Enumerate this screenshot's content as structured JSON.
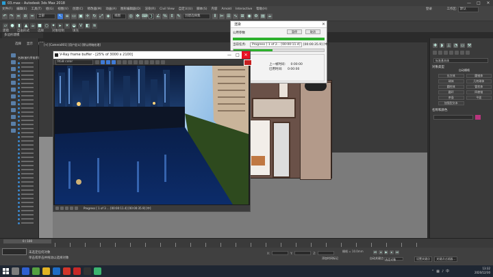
{
  "window": {
    "title": "03.max - Autodesk 3ds Max 2018",
    "controls": [
      "—",
      "□",
      "✕"
    ]
  },
  "menu": [
    "文件(F)",
    "编辑(E)",
    "工具(T)",
    "组(G)",
    "视图(V)",
    "创建(C)",
    "修改器(M)",
    "动画(A)",
    "图形编辑器(D)",
    "渲染(R)",
    "Civil View",
    "自定义(U)",
    "脚本(S)",
    "内容",
    "Arnold",
    "Interactive",
    "帮助(H)"
  ],
  "toolbar": {
    "selection_filter": "全部",
    "view_dropdown": "视图",
    "selection_set": "创建选择集"
  },
  "login": {
    "user": "登录",
    "workspace_label": "工作区:",
    "workspace": "默认"
  },
  "ribbon": {
    "tabs": [
      "建模",
      "自由形式",
      "选择",
      "对象绘制",
      "填充"
    ],
    "stage_label": "多边形建模"
  },
  "explorer": {
    "header": [
      "选择",
      "显示",
      "编辑"
    ],
    "root": "名称(按升序排序)",
    "rows": 40
  },
  "viewport": {
    "label": "[+] [Camera001] [用户定义] [默认明暗处理]"
  },
  "dialog": {
    "title": "渲染",
    "row1_label": "公用参数",
    "pause_label": "暂停",
    "cancel_label": "取消",
    "task_label": "当前任务:",
    "task_value": "Progress [ 1 of 2... [00:00:11.4]",
    "task_value2": "[00:00:35.9] [中]",
    "elapsed_label": "上一帧时间:",
    "elapsed_value": "0:00:00",
    "total_label": "已用时间:",
    "total_value": "0:00:00",
    "frame_label": "帧数:",
    "progress_task": 1.0,
    "progress_overall": 0.43
  },
  "vfb": {
    "title": "V-Ray frame buffer - [25% of 3000 x 2100]",
    "channel": "RGB color",
    "status": "Progress [ 1 of 3 ... [00:00:11.4] [00:00:35.9] [中]",
    "controls": [
      "—",
      "□",
      "✕"
    ]
  },
  "command_panel": {
    "dropdown": "标准基本体",
    "rollout1": "对象类型",
    "autogrid": "自动栅格",
    "objects": [
      "长方体",
      "圆锥体",
      "球体",
      "几何球体",
      "圆柱体",
      "管状体",
      "圆环",
      "四棱锥",
      "茶壶",
      "平面",
      "加强型文本"
    ],
    "rollout2": "名称和颜色",
    "color": "#b9357d"
  },
  "timeline": {
    "slider": "0 / 100"
  },
  "status": {
    "line1": "未选定任何对象",
    "line2": "单击或单击并拖动以选择对象",
    "x_label": "X:",
    "y_label": "Y:",
    "z_label": "Z:",
    "grid": "栅格 = 10.0mm",
    "add_time_tag": "添加时间标记",
    "autokey": "自动关键点",
    "autokey_value": "选定对象",
    "setkey": "设置关键点",
    "filters": "关键点过滤器..."
  },
  "taskbar": {
    "time": "13:32",
    "date": "2020/12/30",
    "lang": "中",
    "apps": [
      "#7d7d7d",
      "#2f5fd0",
      "#56a040",
      "#e2b324",
      "#1d6cc6",
      "#d2352a",
      "#c62828",
      "#333",
      "#3bb36e"
    ]
  }
}
